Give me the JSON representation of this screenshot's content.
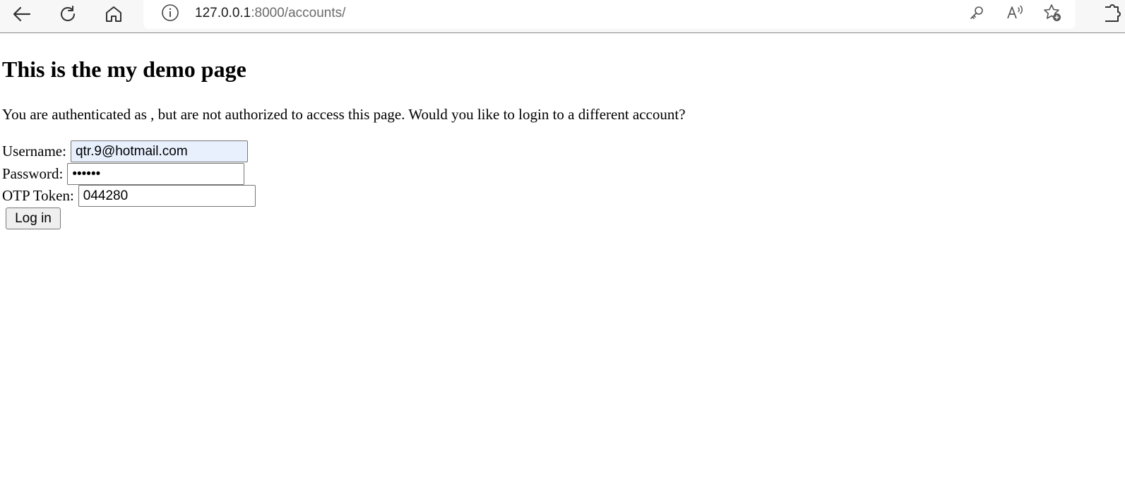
{
  "browser": {
    "url_host": "127.0.0.1",
    "url_rest": ":8000/accounts/",
    "icons": [
      "back-arrow-icon",
      "refresh-icon",
      "home-icon",
      "info-icon",
      "key-icon",
      "read-aloud-icon",
      "add-favorite-icon",
      "extensions-icon"
    ]
  },
  "page": {
    "heading": "This is the my demo page",
    "message": "You are authenticated as , but are not authorized to access this page. Would you like to login to a different account?"
  },
  "form": {
    "username_label": "Username:",
    "username_value": "qtr.9@hotmail.com",
    "password_label": "Password:",
    "password_value": "••••••",
    "otp_label": "OTP Token:",
    "otp_value": "044280",
    "submit_label": "Log in"
  },
  "colors": {
    "autofill_bg": "#e8f0fe",
    "toolbar_bg": "#f7f7f7"
  }
}
